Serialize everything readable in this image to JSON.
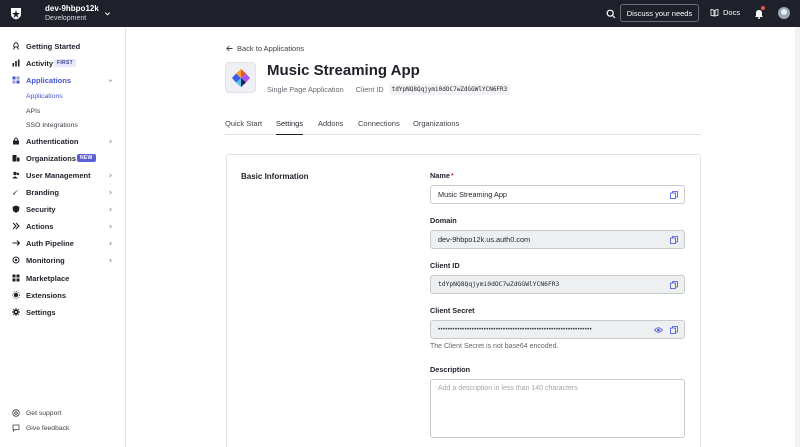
{
  "topbar": {
    "tenant_name": "dev-9hbpo12k",
    "tenant_env": "Development",
    "discuss_label": "Discuss your needs",
    "docs_label": "Docs"
  },
  "sidebar": {
    "items": [
      {
        "label": "Getting Started",
        "icon": "rocket-icon"
      },
      {
        "label": "Activity",
        "icon": "activity-icon",
        "badge": "FIRST"
      },
      {
        "label": "Applications",
        "icon": "applications-icon"
      },
      {
        "label": "Authentication",
        "icon": "authentication-icon"
      },
      {
        "label": "Organizations",
        "icon": "organizations-icon",
        "badge": "NEW"
      },
      {
        "label": "User Management",
        "icon": "users-icon"
      },
      {
        "label": "Branding",
        "icon": "branding-icon"
      },
      {
        "label": "Security",
        "icon": "shield-icon"
      },
      {
        "label": "Actions",
        "icon": "actions-icon"
      },
      {
        "label": "Auth Pipeline",
        "icon": "pipeline-icon"
      },
      {
        "label": "Monitoring",
        "icon": "monitoring-icon"
      },
      {
        "label": "Marketplace",
        "icon": "marketplace-icon"
      },
      {
        "label": "Extensions",
        "icon": "extensions-icon"
      },
      {
        "label": "Settings",
        "icon": "gear-icon"
      }
    ],
    "subitems": [
      "Applications",
      "APIs",
      "SSO Integrations"
    ],
    "footer": [
      "Get support",
      "Give feedback"
    ]
  },
  "main": {
    "back_label": "Back to Applications",
    "app_title": "Music Streaming App",
    "app_type": "Single Page Application",
    "client_id_label": "Client ID",
    "client_id_value": "tdYpNQ8Qqjymi0dOC7wZdGGWlYCN6FR3",
    "tabs": [
      "Quick Start",
      "Settings",
      "Addons",
      "Connections",
      "Organizations"
    ],
    "active_tab": "Settings",
    "section_title": "Basic Information",
    "fields": {
      "name_label": "Name",
      "name_required": "*",
      "name_value": "Music Streaming App",
      "domain_label": "Domain",
      "domain_value": "dev-9hbpo12k.us.auth0.com",
      "client_id_label": "Client ID",
      "client_id_value": "tdYpNQ8Qqjymi0dOC7wZdGGWlYCN6FR3",
      "client_secret_label": "Client Secret",
      "client_secret_masked": "••••••••••••••••••••••••••••••••••••••••••••••••••••••••••••••••",
      "client_secret_help": "The Client Secret is not base64 encoded.",
      "description_label": "Description",
      "description_placeholder": "Add a description in less than 140 characters"
    }
  },
  "colors": {
    "topbar_bg": "#1e212a",
    "accent": "#4552d6"
  }
}
